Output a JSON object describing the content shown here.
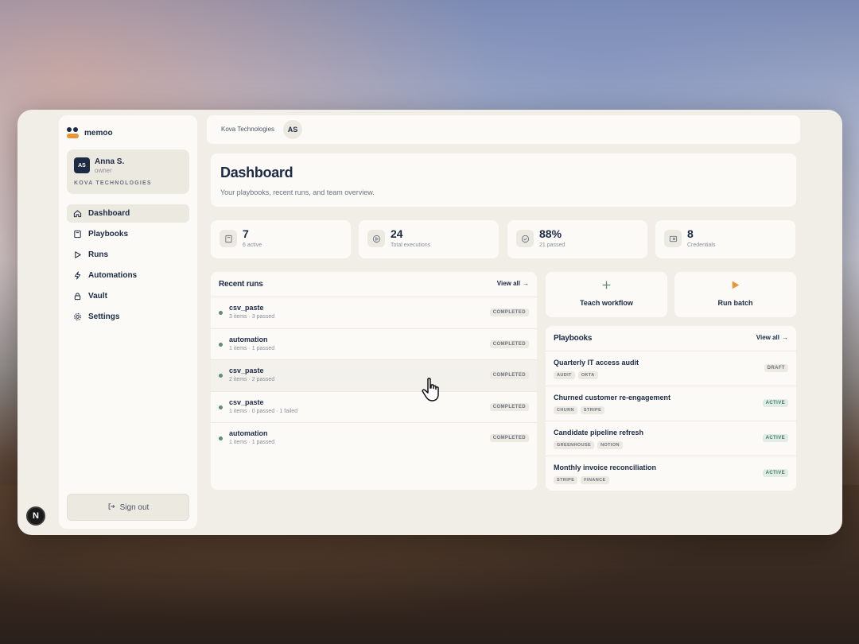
{
  "brand": {
    "name": "memoo"
  },
  "user": {
    "initials": "AS",
    "name": "Anna S.",
    "role": "owner",
    "org": "KOVA TECHNOLOGIES"
  },
  "nav": [
    {
      "label": "Dashboard",
      "icon": "home-icon",
      "active": true
    },
    {
      "label": "Playbooks",
      "icon": "book-icon",
      "active": false
    },
    {
      "label": "Runs",
      "icon": "play-icon",
      "active": false
    },
    {
      "label": "Automations",
      "icon": "lightning-icon",
      "active": false
    },
    {
      "label": "Vault",
      "icon": "lock-icon",
      "active": false
    },
    {
      "label": "Settings",
      "icon": "gear-icon",
      "active": false
    }
  ],
  "signout_label": "Sign out",
  "help_label": "N",
  "topbar": {
    "org_name": "Kova Technologies",
    "avatar": "AS"
  },
  "header": {
    "title": "Dashboard",
    "subtitle": "Your playbooks, recent runs, and team overview."
  },
  "stats": [
    {
      "value": "7",
      "label": "6 active",
      "icon": "book-icon"
    },
    {
      "value": "24",
      "label": "Total executions",
      "icon": "play-circle-icon"
    },
    {
      "value": "88%",
      "label": "21 passed",
      "icon": "check-circle-icon"
    },
    {
      "value": "8",
      "label": "Credentials",
      "icon": "key-icon"
    }
  ],
  "recent_runs": {
    "title": "Recent runs",
    "view_all": "View all",
    "rows": [
      {
        "name": "csv_paste",
        "meta": "3 items · 3 passed",
        "status": "COMPLETED"
      },
      {
        "name": "automation",
        "meta": "1 items · 1 passed",
        "status": "COMPLETED"
      },
      {
        "name": "csv_paste",
        "meta": "2 items · 2 passed",
        "status": "COMPLETED"
      },
      {
        "name": "csv_paste",
        "meta": "1 items · 0 passed · 1 failed",
        "status": "COMPLETED"
      },
      {
        "name": "automation",
        "meta": "1 items · 1 passed",
        "status": "COMPLETED"
      }
    ]
  },
  "actions": {
    "teach": {
      "label": "Teach workflow",
      "icon": "plus-icon"
    },
    "run_batch": {
      "label": "Run batch",
      "icon": "play-icon"
    }
  },
  "playbooks": {
    "title": "Playbooks",
    "view_all": "View all",
    "rows": [
      {
        "name": "Quarterly IT access audit",
        "tags": [
          "AUDIT",
          "OKTA"
        ],
        "status": "DRAFT"
      },
      {
        "name": "Churned customer re-engagement",
        "tags": [
          "CHURN",
          "STRIPE"
        ],
        "status": "ACTIVE"
      },
      {
        "name": "Candidate pipeline refresh",
        "tags": [
          "GREENHOUSE",
          "NOTION"
        ],
        "status": "ACTIVE"
      },
      {
        "name": "Monthly invoice reconciliation",
        "tags": [
          "STRIPE",
          "FINANCE"
        ],
        "status": "ACTIVE"
      }
    ]
  },
  "colors": {
    "accent": "#e8963c",
    "navy": "#1c2a44",
    "success": "#5f8b77",
    "surface": "#f1eee7"
  }
}
